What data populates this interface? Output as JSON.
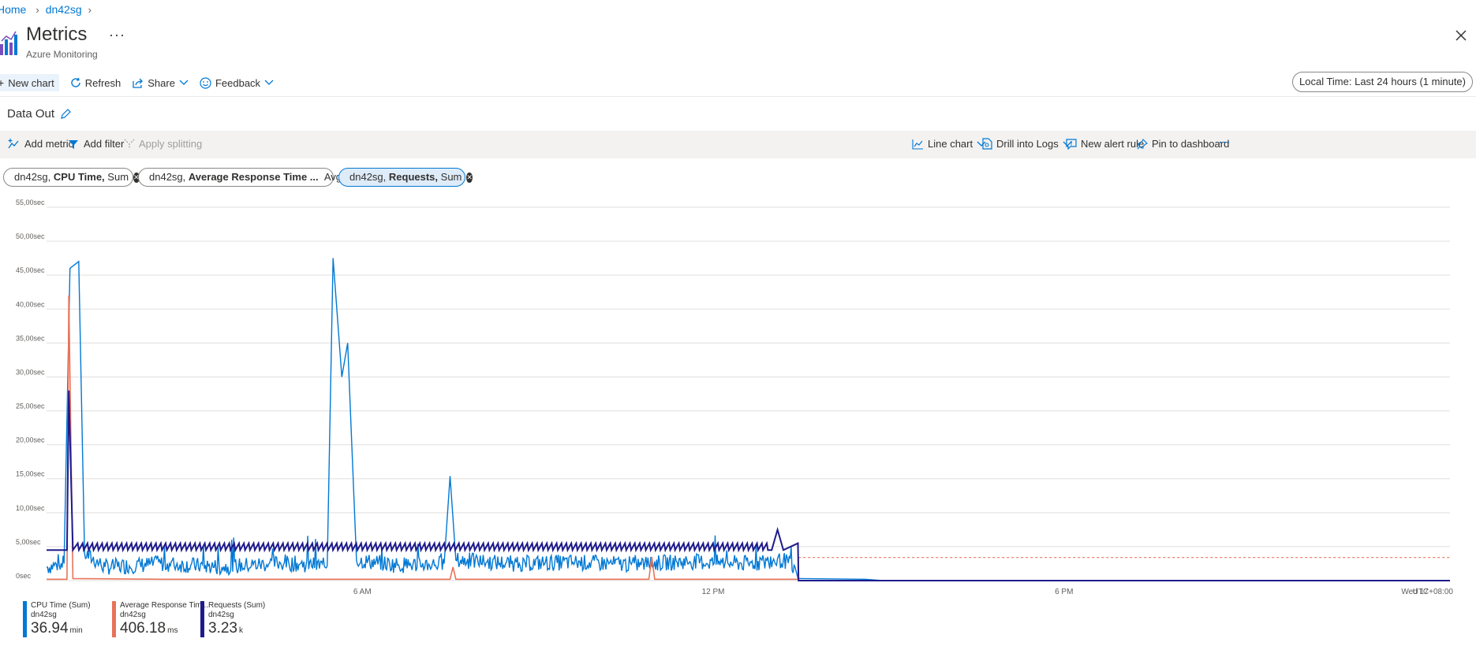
{
  "breadcrumb": {
    "home": "Home",
    "resource": "dn42sg"
  },
  "header": {
    "title": "Metrics",
    "subtitle": "Azure Monitoring",
    "more": "···"
  },
  "toolbar": {
    "new_chart": "New chart",
    "refresh": "Refresh",
    "share": "Share",
    "feedback": "Feedback",
    "time_range": "Local Time: Last 24 hours (1 minute)"
  },
  "chart_title": "Data Out",
  "chart_toolbar": {
    "add_metric": "Add metric",
    "add_filter": "Add filter",
    "apply_splitting": "Apply splitting",
    "line_chart": "Line chart",
    "drill_logs": "Drill into Logs",
    "new_alert": "New alert rule",
    "pin_dashboard": "Pin to dashboard",
    "more": "···"
  },
  "metric_pills": [
    {
      "resource": "dn42sg,",
      "metric": "CPU Time,",
      "agg": "Sum"
    },
    {
      "resource": "dn42sg,",
      "metric": "Average Response Time ...",
      "agg": "Avg"
    },
    {
      "resource": "dn42sg,",
      "metric": "Requests,",
      "agg": "Sum"
    }
  ],
  "colors": {
    "cpu": "#0078d4",
    "response": "#e8735a",
    "requests": "#1f1b8c",
    "accent": "#0078d4"
  },
  "chart_data": {
    "type": "line",
    "y_tick_labels": [
      "55,00sec",
      "50,00sec",
      "45,00sec",
      "40,00sec",
      "35,00sec",
      "30,00sec",
      "25,00sec",
      "20,00sec",
      "15,00sec",
      "10,00sec",
      "5,00sec",
      "0sec"
    ],
    "x_tick_labels": [
      "6 AM",
      "12 PM",
      "6 PM",
      "Wed 17"
    ],
    "timezone_label": "UTC+08:00",
    "ylim": [
      0,
      55
    ],
    "x_range_hours": [
      0,
      24
    ],
    "series": [
      {
        "name": "CPU Time (Sum)",
        "points": [
          [
            0.0,
            2
          ],
          [
            0.3,
            2.5
          ],
          [
            0.4,
            46
          ],
          [
            0.55,
            47
          ],
          [
            0.65,
            4
          ],
          [
            1.0,
            2
          ],
          [
            2,
            2.5
          ],
          [
            3,
            2
          ],
          [
            4,
            2.6
          ],
          [
            4.8,
            2.2
          ],
          [
            4.9,
            47.5
          ],
          [
            5.05,
            30
          ],
          [
            5.15,
            35
          ],
          [
            5.3,
            3
          ],
          [
            6,
            2.3
          ],
          [
            6.8,
            2.5
          ],
          [
            6.9,
            15.4
          ],
          [
            7.0,
            3
          ],
          [
            8,
            2.5
          ],
          [
            9,
            2.7
          ],
          [
            10,
            2.4
          ],
          [
            11,
            2.8
          ],
          [
            12,
            2.5
          ],
          [
            12.6,
            3
          ],
          [
            12.8,
            2
          ],
          [
            12.85,
            0.3
          ],
          [
            14,
            0.2
          ],
          [
            14.3,
            0
          ],
          [
            24,
            0
          ]
        ]
      },
      {
        "name": "Average Response Time (Avg)",
        "points": [
          [
            0.0,
            0.2
          ],
          [
            0.35,
            0.2
          ],
          [
            0.38,
            42
          ],
          [
            0.45,
            0.3
          ],
          [
            2,
            0.2
          ],
          [
            6.9,
            0.2
          ],
          [
            6.95,
            2
          ],
          [
            7.0,
            0.2
          ],
          [
            10.3,
            0.2
          ],
          [
            10.35,
            3.5
          ],
          [
            10.4,
            0.2
          ],
          [
            12.85,
            0.2
          ],
          [
            12.86,
            3.4
          ],
          [
            24,
            3.4
          ]
        ]
      },
      {
        "name": "Requests (Sum)",
        "points": [
          [
            0,
            4.5
          ],
          [
            0.35,
            4.5
          ],
          [
            0.38,
            28
          ],
          [
            0.45,
            4.5
          ],
          [
            12.4,
            4.5
          ],
          [
            12.5,
            7.5
          ],
          [
            12.6,
            4.5
          ],
          [
            12.85,
            5.5
          ],
          [
            12.86,
            0
          ],
          [
            24,
            0
          ]
        ]
      }
    ],
    "legend": [
      {
        "label": "CPU Time (Sum)",
        "resource": "dn42sg",
        "value": "36.94",
        "unit": "min"
      },
      {
        "label": "Average Response Tim...",
        "resource": "dn42sg",
        "value": "406.18",
        "unit": "ms"
      },
      {
        "label": "Requests (Sum)",
        "resource": "dn42sg",
        "value": "3.23",
        "unit": "k"
      }
    ],
    "grid": true,
    "legend_placement": "bottom-left"
  }
}
